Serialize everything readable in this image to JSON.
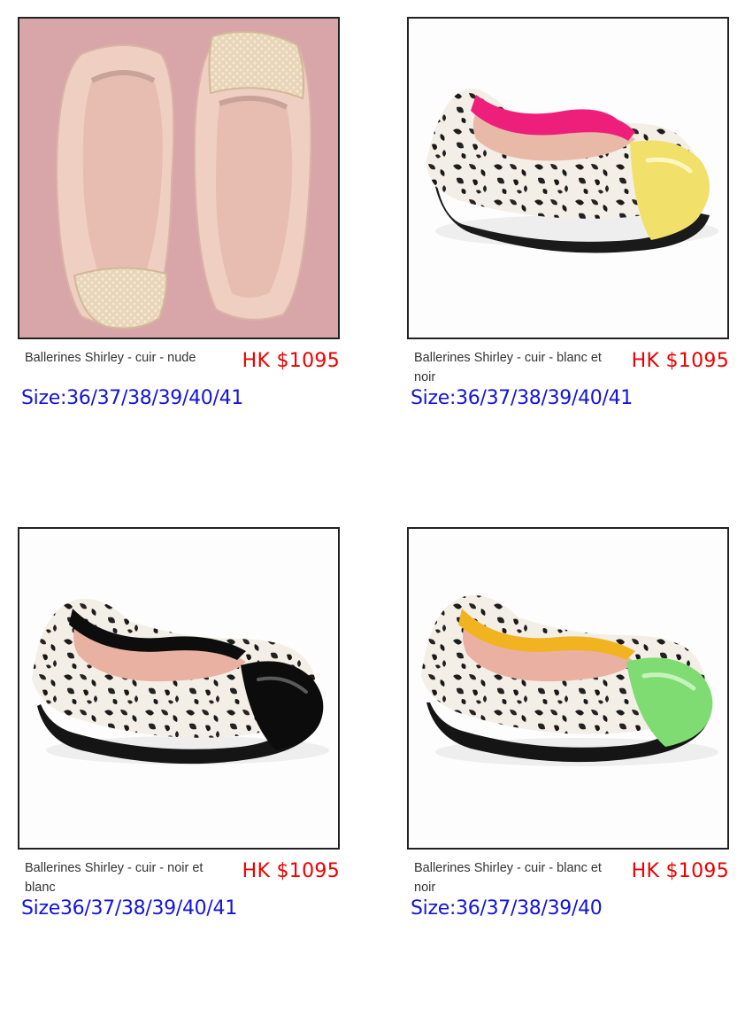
{
  "products": [
    {
      "name": "Ballerines Shirley - cuir - nude",
      "price": "HK $1095",
      "sizes": "Size:36/37/38/39/40/41",
      "image": "pink-ballerina-flats-pair-image"
    },
    {
      "name": "Ballerines Shirley - cuir - blanc et noir",
      "price": "HK $1095",
      "sizes": "Size:36/37/38/39/40/41",
      "image": "leopard-flat-yellow-toe-image"
    },
    {
      "name": "Ballerines Shirley - cuir - noir et blanc",
      "price": "HK $1095",
      "sizes": "Size36/37/38/39/40/41",
      "image": "leopard-flat-black-toe-image"
    },
    {
      "name": "Ballerines Shirley - cuir - blanc et noir",
      "price": "HK $1095",
      "sizes": "Size:36/37/38/39/40",
      "image": "leopard-flat-green-toe-image"
    }
  ],
  "colors": {
    "price": "#ee0000",
    "size": "#1414dc",
    "name": "#333333",
    "border": "#222222"
  }
}
